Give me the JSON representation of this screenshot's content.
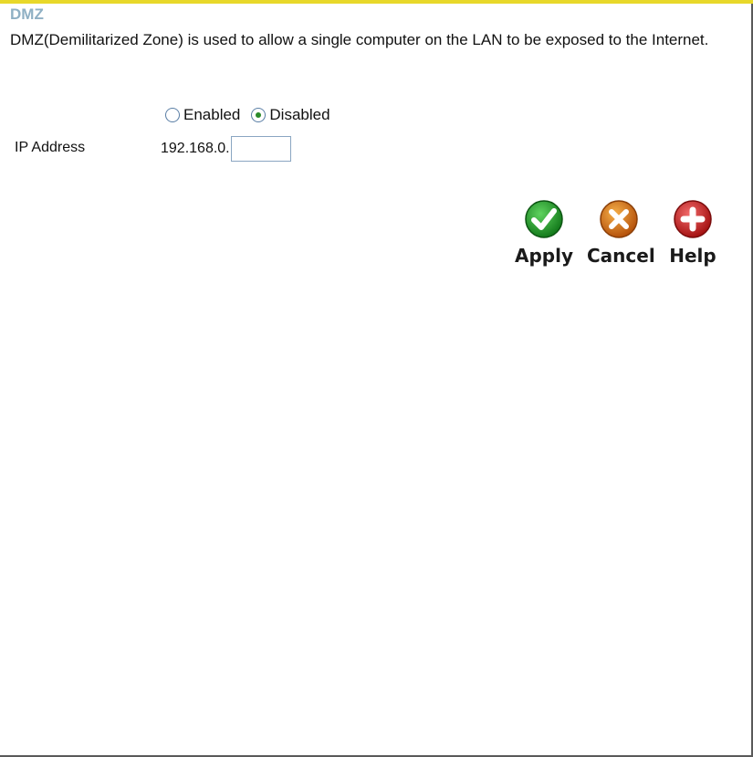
{
  "section": {
    "title": "DMZ",
    "description": "DMZ(Demilitarized Zone) is used to allow a single computer on the LAN to be exposed to the Internet."
  },
  "dmz_mode": {
    "options": [
      {
        "label": "Enabled",
        "checked": false
      },
      {
        "label": "Disabled",
        "checked": true
      }
    ]
  },
  "ip": {
    "label": "IP Address",
    "prefix": "192.168.0.",
    "value": ""
  },
  "actions": {
    "apply_label": "Apply",
    "cancel_label": "Cancel",
    "help_label": "Help",
    "icons": {
      "apply": "check-icon",
      "cancel": "x-icon",
      "help": "plus-icon"
    },
    "colors": {
      "apply": "#1f9a2a",
      "cancel": "#e07a14",
      "help": "#d62222"
    }
  },
  "theme": {
    "top_bar": "#e8d82a",
    "title_color": "#8fb0c4"
  }
}
